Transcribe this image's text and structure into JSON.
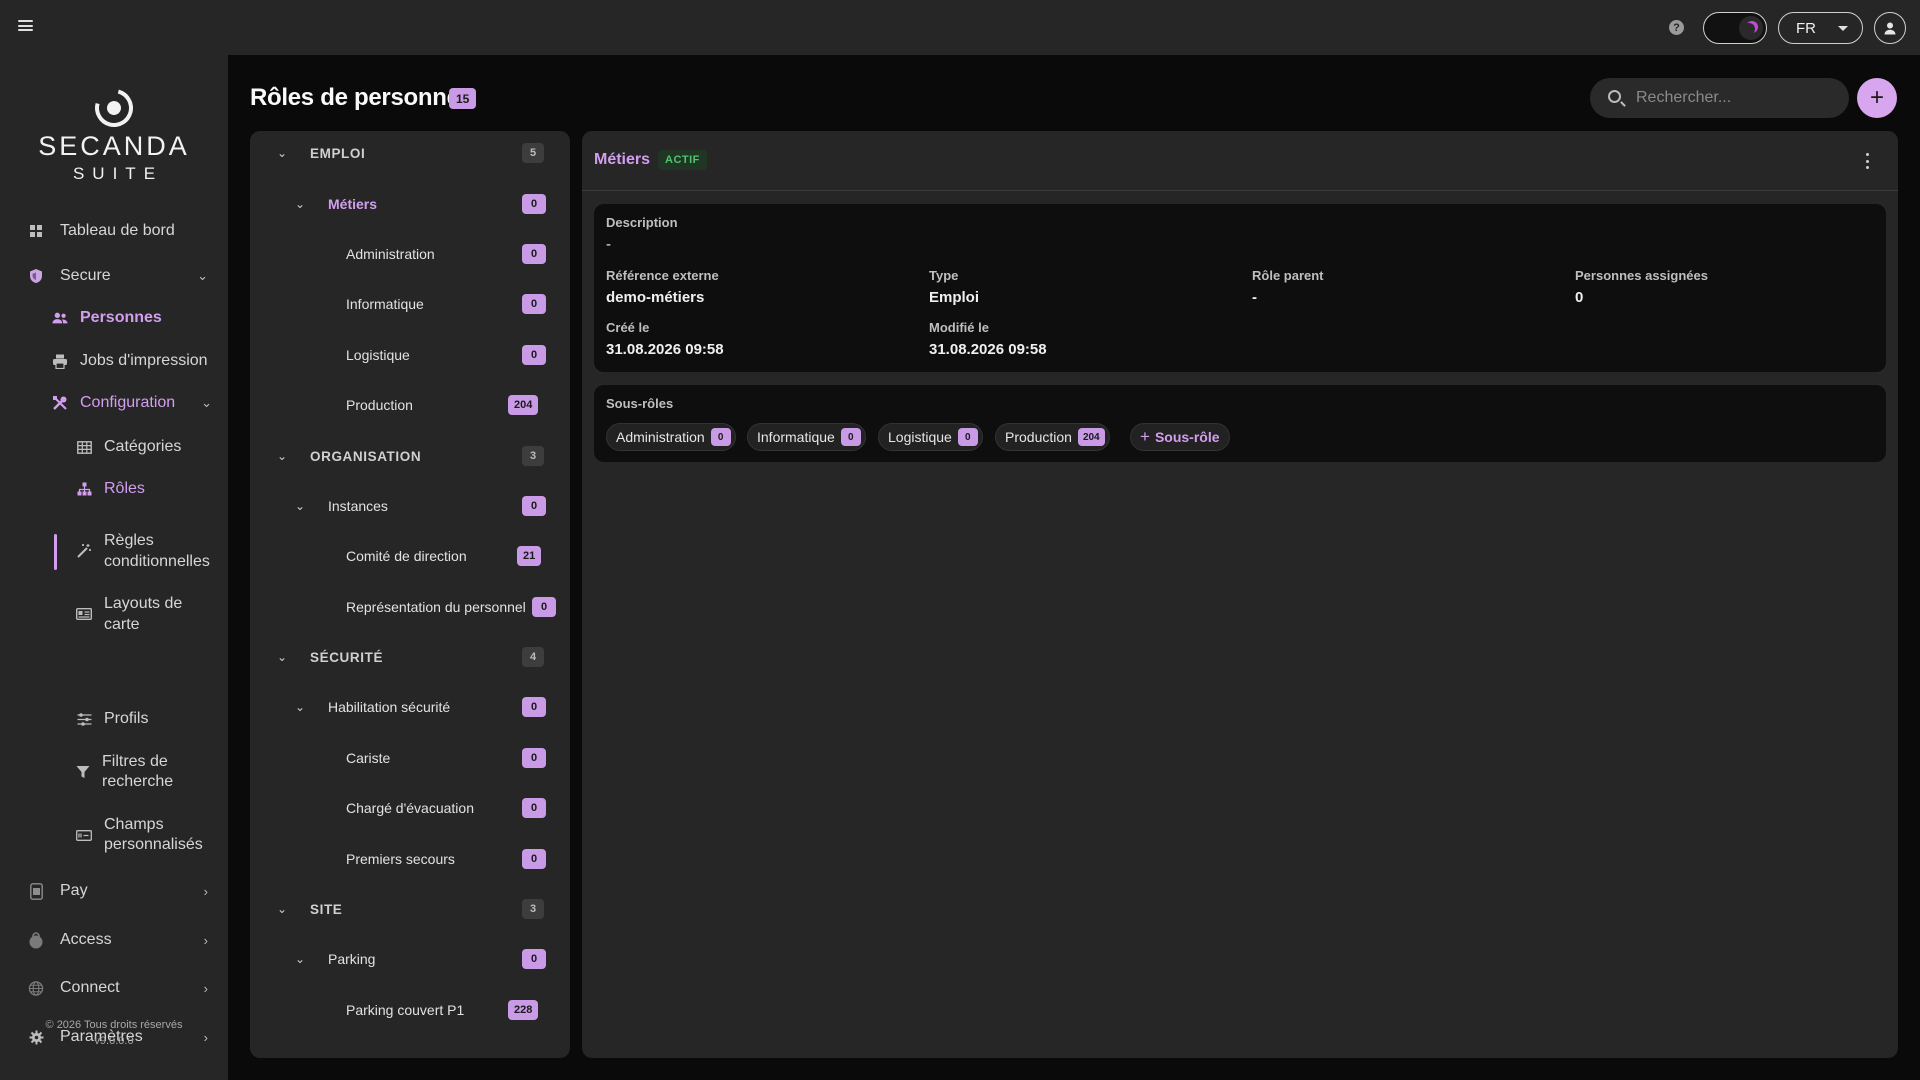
{
  "topbar": {
    "language": "FR"
  },
  "sidebar": {
    "logo_title": "SECANDA",
    "logo_sub": "SUITE",
    "items": {
      "dashboard": "Tableau de bord",
      "secure": "Secure",
      "persons": "Personnes",
      "print_jobs": "Jobs d'impression",
      "configuration": "Configuration",
      "categories": "Catégories",
      "roles": "Rôles",
      "conditional_rules": "Règles conditionnelles",
      "card_layouts": "Layouts de carte",
      "profiles": "Profils",
      "search_filters": "Filtres de recherche",
      "custom_fields": "Champs personnalisés",
      "pay": "Pay",
      "access": "Access",
      "connect": "Connect",
      "settings": "Paramètres"
    },
    "copyright": "© 2026 Tous droits réservés",
    "version": "v9.0.0.0"
  },
  "page": {
    "title": "Rôles de personne",
    "count": "15",
    "search_placeholder": "Rechercher..."
  },
  "tree": [
    {
      "label": "EMPLOI",
      "count": "5"
    },
    {
      "label": "Métiers",
      "count": "0"
    },
    {
      "label": "Administration",
      "count": "0"
    },
    {
      "label": "Informatique",
      "count": "0"
    },
    {
      "label": "Logistique",
      "count": "0"
    },
    {
      "label": "Production",
      "count": "204"
    },
    {
      "label": "ORGANISATION",
      "count": "3"
    },
    {
      "label": "Instances",
      "count": "0"
    },
    {
      "label": "Comité de direction",
      "count": "21"
    },
    {
      "label": "Représentation du personnel",
      "count": "0"
    },
    {
      "label": "SÉCURITÉ",
      "count": "4"
    },
    {
      "label": "Habilitation sécurité",
      "count": "0"
    },
    {
      "label": "Cariste",
      "count": "0"
    },
    {
      "label": "Chargé d'évacuation",
      "count": "0"
    },
    {
      "label": "Premiers secours",
      "count": "0"
    },
    {
      "label": "SITE",
      "count": "3"
    },
    {
      "label": "Parking",
      "count": "0"
    },
    {
      "label": "Parking couvert P1",
      "count": "228"
    }
  ],
  "detail": {
    "title": "Métiers",
    "status": "ACTIF",
    "description_label": "Description",
    "description_value": "-",
    "external_ref_label": "Référence externe",
    "external_ref_value": "demo-métiers",
    "type_label": "Type",
    "type_value": "Emploi",
    "parent_label": "Rôle parent",
    "parent_value": "-",
    "assigned_label": "Personnes assignées",
    "assigned_value": "0",
    "created_label": "Créé le",
    "created_value": "31.08.2026 09:58",
    "modified_label": "Modifié le",
    "modified_value": "31.08.2026 09:58",
    "subroles_label": "Sous-rôles",
    "subroles": [
      {
        "label": "Administration",
        "count": "0"
      },
      {
        "label": "Informatique",
        "count": "0"
      },
      {
        "label": "Logistique",
        "count": "0"
      },
      {
        "label": "Production",
        "count": "204"
      }
    ],
    "add_subrole": "Sous-rôle"
  },
  "colors": {
    "accent": "#d39ef0",
    "badge": "#c99ae6",
    "active_status": "#4fc46b",
    "panel": "#262626",
    "background": "#0a0a0a"
  },
  "icons": [
    "menu-icon",
    "help-icon",
    "moon-icon",
    "user-icon",
    "search-icon",
    "plus-icon",
    "more-vertical-icon",
    "dashboard-icon",
    "shield-icon",
    "users-icon",
    "printer-icon",
    "tools-icon",
    "table-icon",
    "hierarchy-icon",
    "magic-wand-icon",
    "id-card-icon",
    "sliders-icon",
    "filter-icon",
    "input-field-icon",
    "wallet-icon",
    "lock-icon",
    "globe-icon",
    "gear-icon",
    "chevron-down-icon",
    "chevron-right-icon"
  ]
}
